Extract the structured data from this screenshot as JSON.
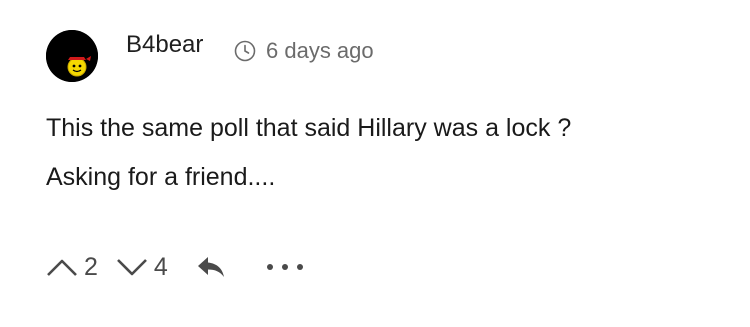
{
  "comment": {
    "username": "B4bear",
    "timestamp": "6 days ago",
    "body": [
      "This the same poll that said Hillary was a lock ?",
      "Asking for a friend...."
    ],
    "upvotes": "2",
    "downvotes": "4"
  },
  "icons": {
    "avatar": "avatar-black-with-yellow-face",
    "timestamp": "clock-icon",
    "upvote": "chevron-up-icon",
    "downvote": "chevron-down-icon",
    "reply": "reply-arrow-icon",
    "more": "more-dots-icon"
  },
  "colors": {
    "username": "#1f1f1f",
    "meta": "#6b6b6b",
    "text": "#1a1a1a",
    "icons": "#4a4a4a",
    "avatar_bg": "#000000",
    "avatar_face": "#f5d800"
  }
}
